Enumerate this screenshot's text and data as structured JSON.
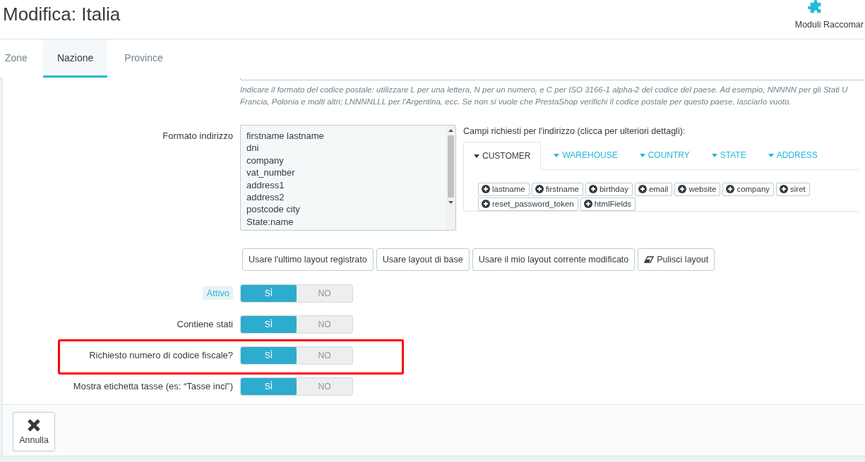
{
  "header": {
    "title": "Modifica: Italia",
    "toolbar_button": "Moduli Raccomar"
  },
  "tabs": [
    {
      "label": "Zone",
      "selected": false
    },
    {
      "label": "Nazione",
      "selected": true
    },
    {
      "label": "Province",
      "selected": false
    }
  ],
  "zip_hint": [
    "Indicare il formato del codice postale: utilizzare L per una lettera, N per un numero, e C per ISO 3166-1 alpha-2 del codice del paese. Ad esempio, NNNNN per gli Stati U",
    "Francia, Polonia e molti altri; LNNNNLLL per l'Argentina, ecc. Se non si vuole che PrestaShop verifichi il codice postale per questo paese, lasciarlo vuoto."
  ],
  "address_format": {
    "label": "Formato indirizzo",
    "lines": [
      "firstname lastname",
      "dni",
      "company",
      "vat_number",
      "address1",
      "address2",
      "postcode city",
      "State:name"
    ],
    "fields_label": "Campi richiesti per l'indirizzo (clicca per ulteriori dettagli):",
    "field_tabs": [
      {
        "label": "CUSTOMER",
        "selected": true
      },
      {
        "label": "WAREHOUSE",
        "selected": false
      },
      {
        "label": "COUNTRY",
        "selected": false
      },
      {
        "label": "STATE",
        "selected": false
      },
      {
        "label": "ADDRESS",
        "selected": false
      }
    ],
    "fields": [
      "lastname",
      "firstname",
      "birthday",
      "email",
      "website",
      "company",
      "siret",
      "reset_password_token",
      "htmlFields"
    ]
  },
  "layout_buttons": [
    {
      "label": "Usare l'ultimo layout registrato",
      "kind": "plain"
    },
    {
      "label": "Usare layout di base",
      "kind": "plain"
    },
    {
      "label": "Usare il mio layout corrente modificato",
      "kind": "plain"
    },
    {
      "label": "Pulisci layout",
      "kind": "eraser"
    }
  ],
  "switches": [
    {
      "label": "Attivo",
      "help": true,
      "on": true,
      "highlighted": false,
      "yes": "SÌ",
      "no": "NO"
    },
    {
      "label": "Contiene stati",
      "help": false,
      "on": true,
      "highlighted": false,
      "yes": "SÌ",
      "no": "NO"
    },
    {
      "label": "Richiesto numero di codice fiscale?",
      "help": false,
      "on": true,
      "highlighted": true,
      "yes": "SÌ",
      "no": "NO"
    },
    {
      "label": "Mostra etichetta tasse (es: “Tasse incl”)",
      "help": false,
      "on": true,
      "highlighted": false,
      "yes": "SÌ",
      "no": "NO"
    }
  ],
  "footer": {
    "cancel": "Annulla"
  }
}
